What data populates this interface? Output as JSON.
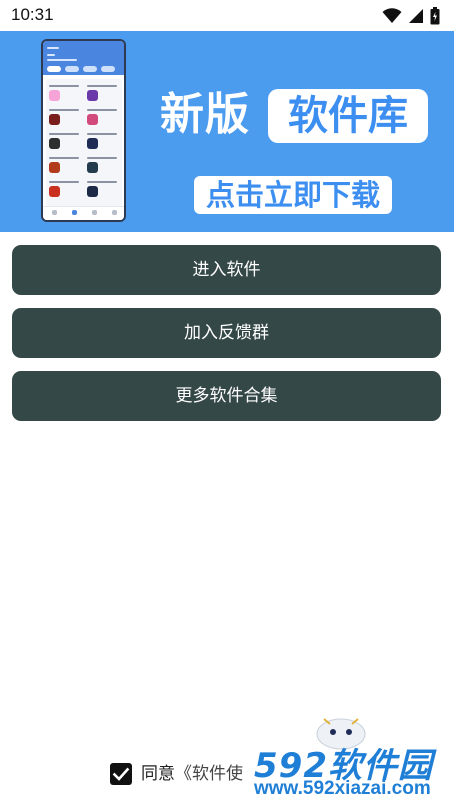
{
  "status_bar": {
    "time": "10:31",
    "icons": [
      "wifi-icon",
      "signal-icon",
      "battery-icon"
    ]
  },
  "banner": {
    "title": "新版",
    "highlight": "软件库",
    "cta": "点击立即下载",
    "background_color": "#4b9bef"
  },
  "buttons": [
    {
      "label": "进入软件"
    },
    {
      "label": "加入反馈群"
    },
    {
      "label": "更多软件合集"
    }
  ],
  "button_color": "#354848",
  "agreement": {
    "checked": true,
    "prefix": "同意",
    "link": "《软件使"
  },
  "watermark": {
    "logo": "592软件园",
    "url": "www.592xiazai.com"
  }
}
